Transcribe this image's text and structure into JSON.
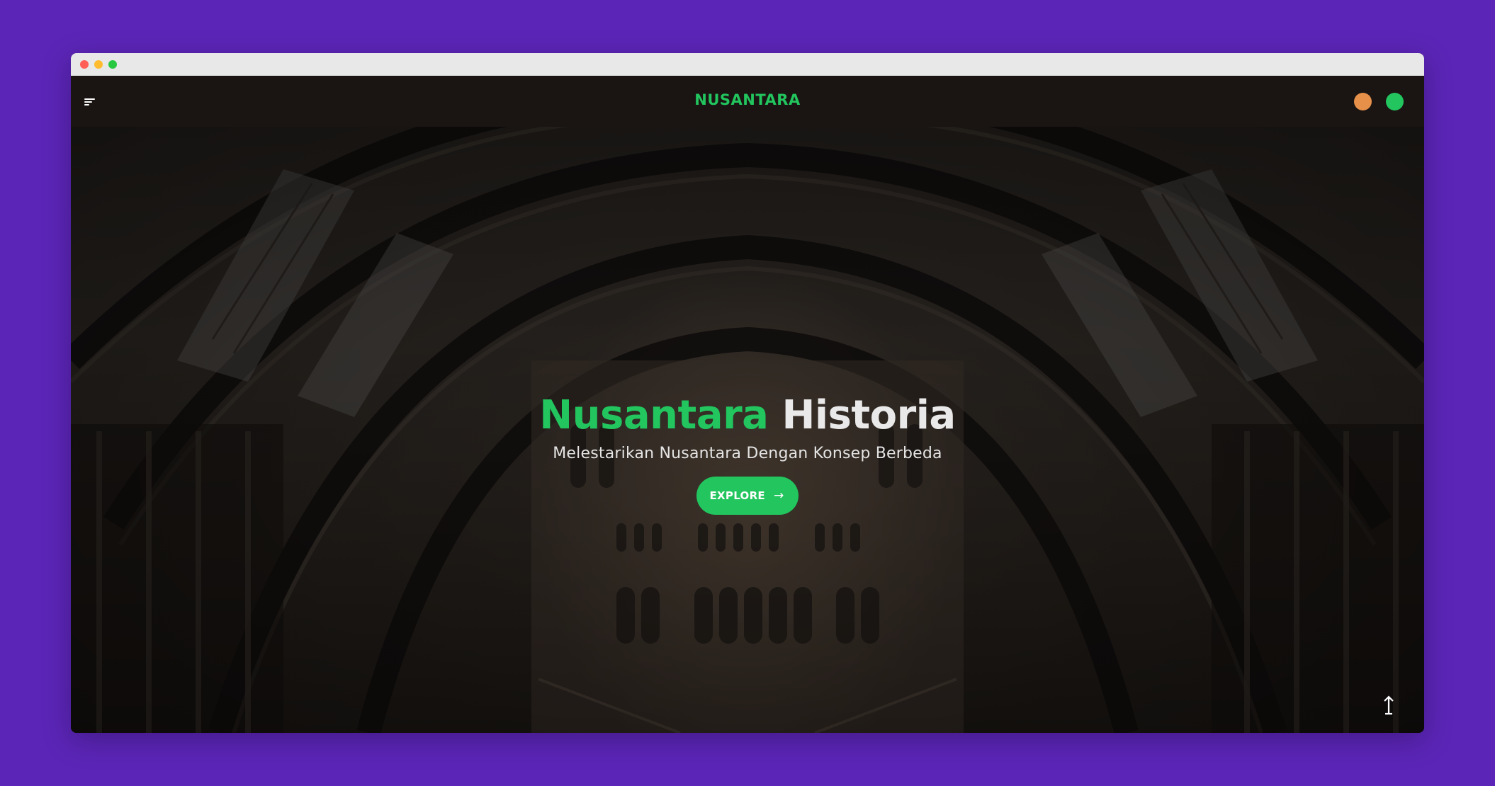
{
  "nav": {
    "brand": "NUSANTARA",
    "menu_icon": "menu-icon",
    "circles": [
      {
        "name": "orange-circle",
        "color": "#e6904a"
      },
      {
        "name": "green-circle",
        "color": "#22c55e"
      }
    ]
  },
  "hero": {
    "title_accent": "Nusantara",
    "title_rest": "Historia",
    "subtitle": "Melestarikan Nusantara Dengan Konsep Berbeda",
    "cta_label": "EXPLORE",
    "cta_icon": "arrow-right-icon",
    "scroll_icon": "arrow-up-icon"
  },
  "colors": {
    "accent": "#22c55e",
    "page_background": "#5b25b7",
    "navbar": "#1a1513"
  }
}
